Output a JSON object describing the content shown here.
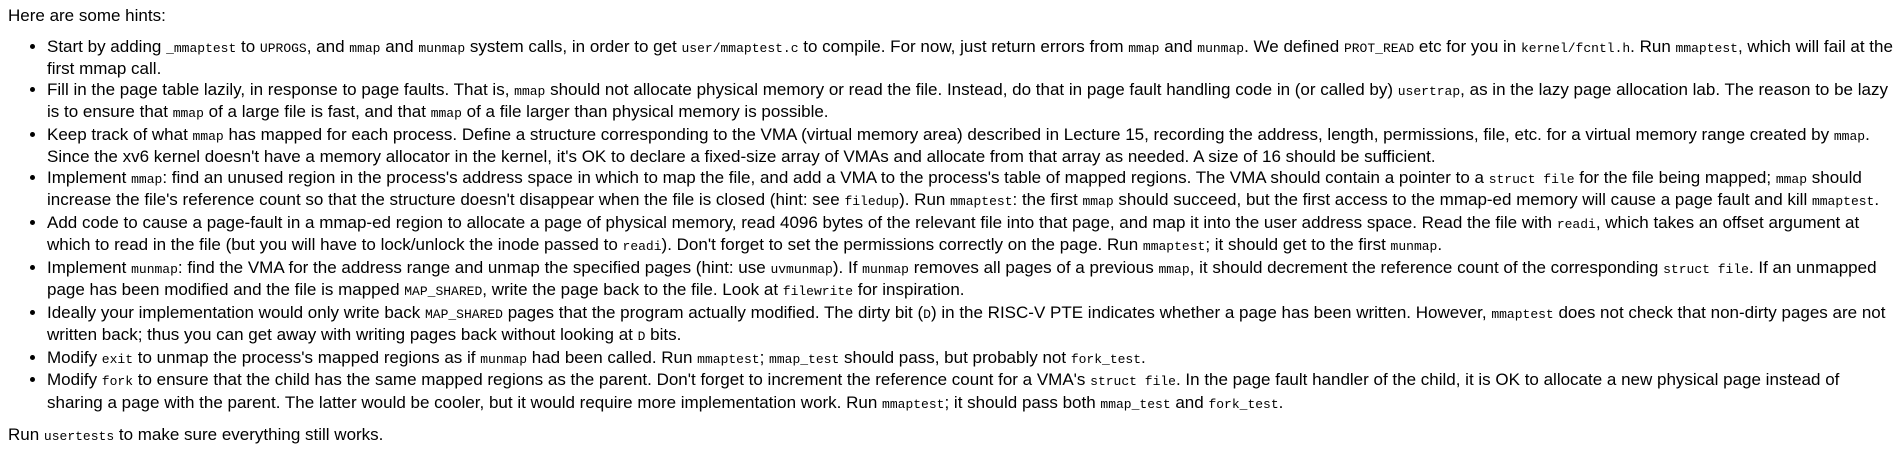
{
  "intro": "Here are some hints:",
  "hints": [
    [
      {
        "t": "Start by adding "
      },
      {
        "c": "_mmaptest"
      },
      {
        "t": " to "
      },
      {
        "c": "UPROGS"
      },
      {
        "t": ", and "
      },
      {
        "c": "mmap"
      },
      {
        "t": " and "
      },
      {
        "c": "munmap"
      },
      {
        "t": " system calls, in order to get "
      },
      {
        "c": "user/mmaptest.c"
      },
      {
        "t": " to compile. For now, just return errors from "
      },
      {
        "c": "mmap"
      },
      {
        "t": " and "
      },
      {
        "c": "munmap"
      },
      {
        "t": ". We defined "
      },
      {
        "c": "PROT_READ"
      },
      {
        "t": " etc for you in "
      },
      {
        "c": "kernel/fcntl.h"
      },
      {
        "t": ". Run "
      },
      {
        "c": "mmaptest"
      },
      {
        "t": ", which will fail at the first mmap call."
      }
    ],
    [
      {
        "t": "Fill in the page table lazily, in response to page faults. That is, "
      },
      {
        "c": "mmap"
      },
      {
        "t": " should not allocate physical memory or read the file. Instead, do that in page fault handling code in (or called by) "
      },
      {
        "c": "usertrap"
      },
      {
        "t": ", as in the lazy page allocation lab. The reason to be lazy is to ensure that "
      },
      {
        "c": "mmap"
      },
      {
        "t": " of a large file is fast, and that "
      },
      {
        "c": "mmap"
      },
      {
        "t": " of a file larger than physical memory is possible."
      }
    ],
    [
      {
        "t": "Keep track of what "
      },
      {
        "c": "mmap"
      },
      {
        "t": " has mapped for each process. Define a structure corresponding to the VMA (virtual memory area) described in Lecture 15, recording the address, length, permissions, file, etc. for a virtual memory range created by "
      },
      {
        "c": "mmap"
      },
      {
        "t": ". Since the xv6 kernel doesn't have a memory allocator in the kernel, it's OK to declare a fixed-size array of VMAs and allocate from that array as needed. A size of 16 should be sufficient."
      }
    ],
    [
      {
        "t": "Implement "
      },
      {
        "c": "mmap"
      },
      {
        "t": ": find an unused region in the process's address space in which to map the file, and add a VMA to the process's table of mapped regions. The VMA should contain a pointer to a "
      },
      {
        "c": "struct file"
      },
      {
        "t": " for the file being mapped; "
      },
      {
        "c": "mmap"
      },
      {
        "t": " should increase the file's reference count so that the structure doesn't disappear when the file is closed (hint: see "
      },
      {
        "c": "filedup"
      },
      {
        "t": "). Run "
      },
      {
        "c": "mmaptest"
      },
      {
        "t": ": the first "
      },
      {
        "c": "mmap"
      },
      {
        "t": " should succeed, but the first access to the mmap-ed memory will cause a page fault and kill "
      },
      {
        "c": "mmaptest"
      },
      {
        "t": "."
      }
    ],
    [
      {
        "t": "Add code to cause a page-fault in a mmap-ed region to allocate a page of physical memory, read 4096 bytes of the relevant file into that page, and map it into the user address space. Read the file with "
      },
      {
        "c": "readi"
      },
      {
        "t": ", which takes an offset argument at which to read in the file (but you will have to lock/unlock the inode passed to "
      },
      {
        "c": "readi"
      },
      {
        "t": "). Don't forget to set the permissions correctly on the page. Run "
      },
      {
        "c": "mmaptest"
      },
      {
        "t": "; it should get to the first "
      },
      {
        "c": "munmap"
      },
      {
        "t": "."
      }
    ],
    [
      {
        "t": "Implement "
      },
      {
        "c": "munmap"
      },
      {
        "t": ": find the VMA for the address range and unmap the specified pages (hint: use "
      },
      {
        "c": "uvmunmap"
      },
      {
        "t": "). If "
      },
      {
        "c": "munmap"
      },
      {
        "t": " removes all pages of a previous "
      },
      {
        "c": "mmap"
      },
      {
        "t": ", it should decrement the reference count of the corresponding "
      },
      {
        "c": "struct file"
      },
      {
        "t": ". If an unmapped page has been modified and the file is mapped "
      },
      {
        "c": "MAP_SHARED"
      },
      {
        "t": ", write the page back to the file. Look at "
      },
      {
        "c": "filewrite"
      },
      {
        "t": " for inspiration."
      }
    ],
    [
      {
        "t": "Ideally your implementation would only write back "
      },
      {
        "c": "MAP_SHARED"
      },
      {
        "t": " pages that the program actually modified. The dirty bit ("
      },
      {
        "c": "D"
      },
      {
        "t": ") in the RISC-V PTE indicates whether a page has been written. However, "
      },
      {
        "c": "mmaptest"
      },
      {
        "t": " does not check that non-dirty pages are not written back; thus you can get away with writing pages back without looking at "
      },
      {
        "c": "D"
      },
      {
        "t": " bits."
      }
    ],
    [
      {
        "t": "Modify "
      },
      {
        "c": "exit"
      },
      {
        "t": " to unmap the process's mapped regions as if "
      },
      {
        "c": "munmap"
      },
      {
        "t": " had been called. Run "
      },
      {
        "c": "mmaptest"
      },
      {
        "t": "; "
      },
      {
        "c": "mmap_test"
      },
      {
        "t": " should pass, but probably not "
      },
      {
        "c": "fork_test"
      },
      {
        "t": "."
      }
    ],
    [
      {
        "t": "Modify "
      },
      {
        "c": "fork"
      },
      {
        "t": " to ensure that the child has the same mapped regions as the parent. Don't forget to increment the reference count for a VMA's "
      },
      {
        "c": "struct file"
      },
      {
        "t": ". In the page fault handler of the child, it is OK to allocate a new physical page instead of sharing a page with the parent. The latter would be cooler, but it would require more implementation work. Run "
      },
      {
        "c": "mmaptest"
      },
      {
        "t": "; it should pass both "
      },
      {
        "c": "mmap_test"
      },
      {
        "t": " and "
      },
      {
        "c": "fork_test"
      },
      {
        "t": "."
      }
    ]
  ],
  "footer": [
    {
      "t": "Run "
    },
    {
      "c": "usertests"
    },
    {
      "t": " to make sure everything still works."
    }
  ]
}
